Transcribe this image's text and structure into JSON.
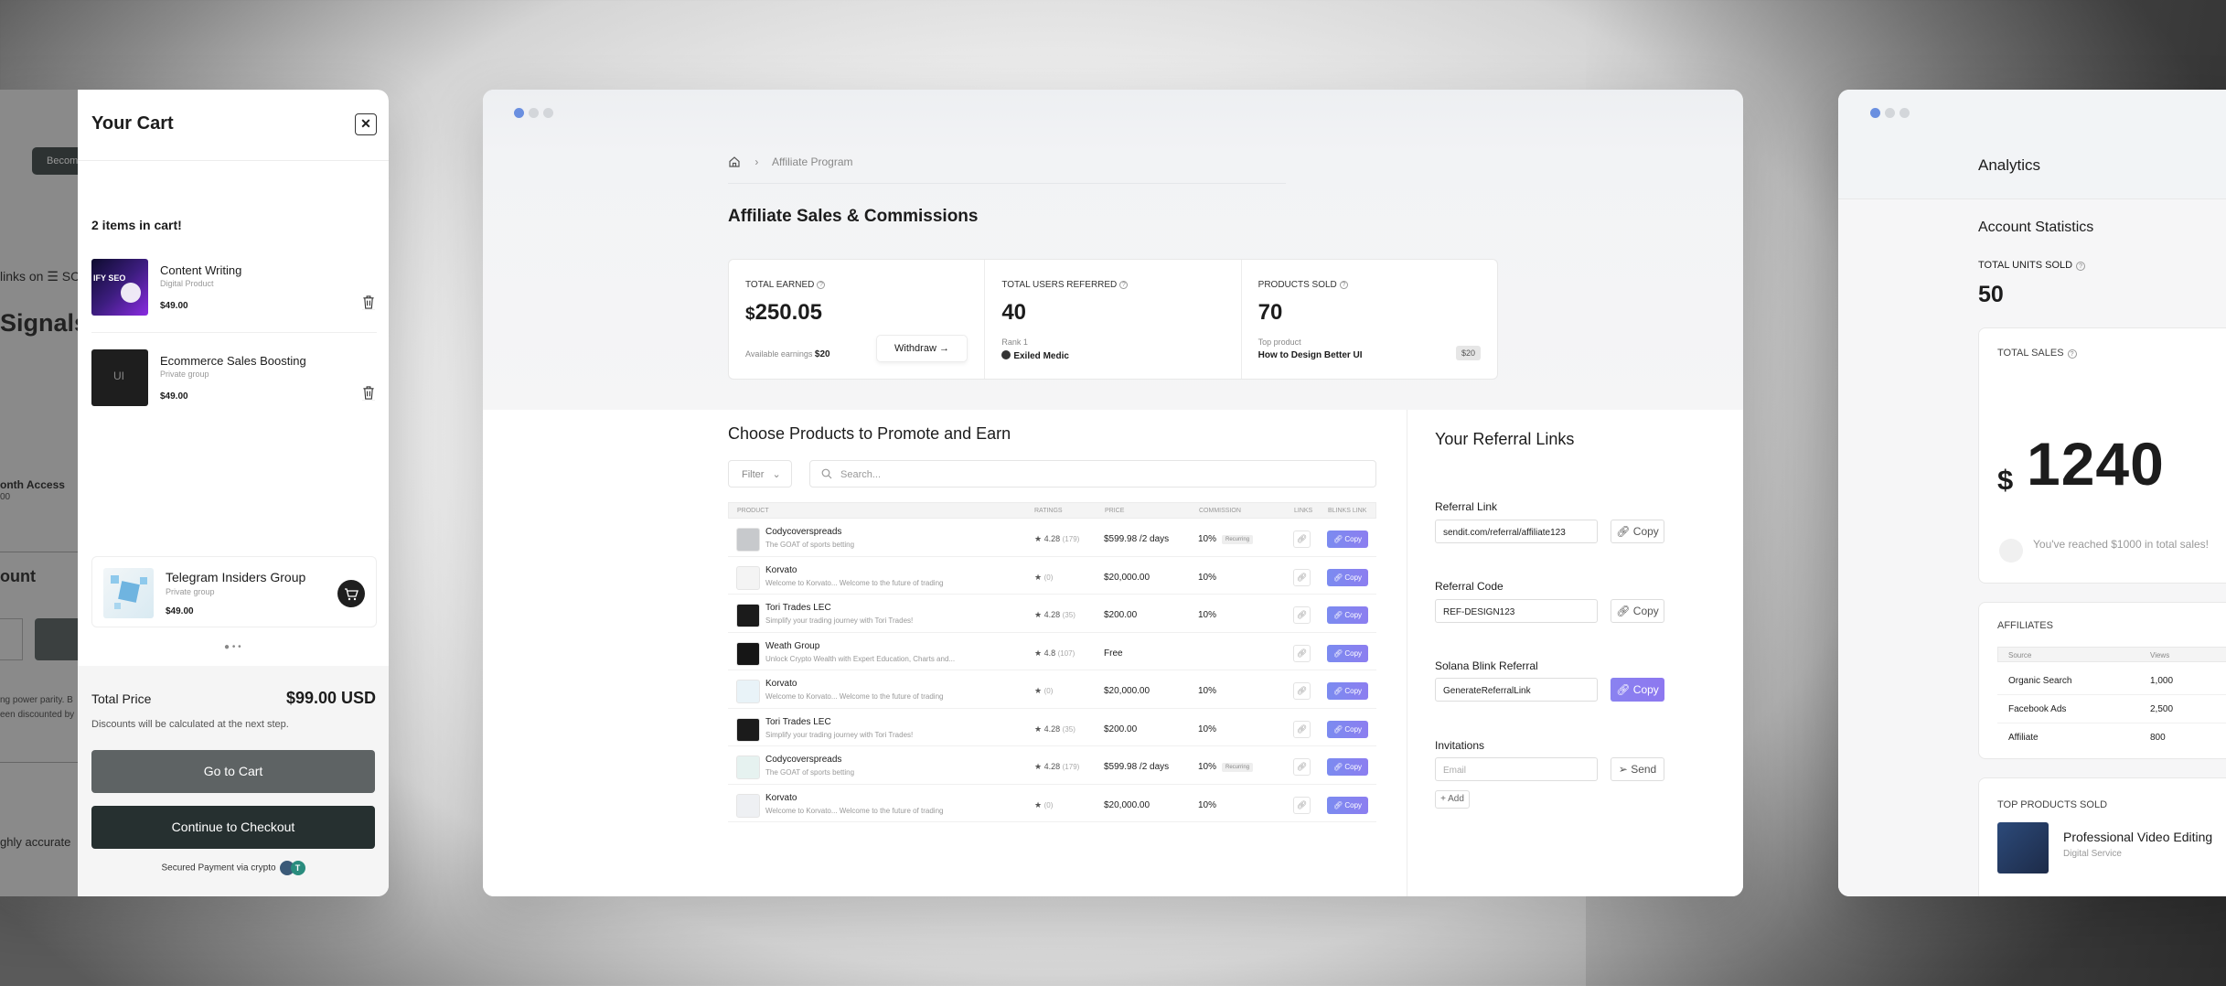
{
  "left_window": {
    "behind": {
      "button": "Become",
      "t1": "links on ☰ SC",
      "t2": "Signals",
      "t3": "onth Access",
      "t3b": "00",
      "t4": "ount",
      "t5a": "ng power parity. B",
      "t5b": "een discounted by",
      "t6": "ghly accurate"
    },
    "cart": {
      "title": "Your Cart",
      "count": "2 items in cart!",
      "items": [
        {
          "name": "Content Writing",
          "sub": "Digital Product",
          "price": "$49.00"
        },
        {
          "name": "Ecommerce Sales Boosting",
          "sub": "Private group",
          "price": "$49.00"
        }
      ],
      "thumb1_text": "IFY SEO",
      "thumb2_text": "UI",
      "recommended": {
        "name": "Telegram Insiders Group",
        "sub": "Private group",
        "price": "$49.00"
      },
      "dots": "● • •",
      "total_label": "Total Price",
      "total_value": "$99.00 USD",
      "discount_note": "Discounts will be calculated at the next step.",
      "go_to_cart": "Go to Cart",
      "checkout": "Continue to Checkout",
      "secured": "Secured Payment via crypto",
      "crypto_badge": "T"
    }
  },
  "middle_window": {
    "breadcrumb": {
      "page": "Affiliate Program",
      "sep": "›"
    },
    "title": "Affiliate Sales & Commissions",
    "stats": {
      "earned_label": "TOTAL EARNED",
      "earned_currency": "$",
      "earned_value": "250.05",
      "available_label": "Available earnings",
      "available_value": "$20",
      "withdraw": "Withdraw",
      "users_label": "TOTAL USERS REFERRED",
      "users_value": "40",
      "rank_label": "Rank 1",
      "rank_name": "Exiled Medic",
      "sold_label": "PRODUCTS SOLD",
      "sold_value": "70",
      "top_label": "Top product",
      "top_name": "How to Design Better UI",
      "top_price": "$20"
    },
    "products": {
      "title": "Choose Products to Promote and Earn",
      "filter": "Filter",
      "search_placeholder": "Search...",
      "headers": {
        "product": "PRODUCT",
        "ratings": "RATINGS",
        "price": "PRICE",
        "commission": "COMMISSION",
        "links": "LINKS",
        "blinks": "BLINKS LINK"
      },
      "copy_label": "Copy",
      "recurring": "Recurring",
      "rows": [
        {
          "name": "Codycoverspreads",
          "desc": "The GOAT of sports betting",
          "rating": "4.28",
          "count": "(179)",
          "price": "$599.98 /2 days",
          "commission": "10%"
        },
        {
          "name": "Korvato",
          "desc": "Welcome to Korvato... Welcome to the future of trading",
          "rating": "",
          "count": "(0)",
          "price": "$20,000.00",
          "commission": "10%"
        },
        {
          "name": "Tori Trades LEC",
          "desc": "Simplify your trading journey with Tori Trades!",
          "rating": "4.28",
          "count": "(35)",
          "price": "$200.00",
          "commission": "10%"
        },
        {
          "name": "Weath Group",
          "desc": "Unlock Crypto Wealth with Expert Education, Charts and...",
          "rating": "4.8",
          "count": "(107)",
          "price": "Free",
          "commission": ""
        },
        {
          "name": "Korvato",
          "desc": "Welcome to Korvato... Welcome to the future of trading",
          "rating": "",
          "count": "(0)",
          "price": "$20,000.00",
          "commission": "10%"
        },
        {
          "name": "Tori Trades LEC",
          "desc": "Simplify your trading journey with Tori Trades!",
          "rating": "4.28",
          "count": "(35)",
          "price": "$200.00",
          "commission": "10%"
        },
        {
          "name": "Codycoverspreads",
          "desc": "The GOAT of sports betting",
          "rating": "4.28",
          "count": "(179)",
          "price": "$599.98 /2 days",
          "commission": "10%"
        },
        {
          "name": "Korvato",
          "desc": "Welcome to Korvato... Welcome to the future of trading",
          "rating": "",
          "count": "(0)",
          "price": "$20,000.00",
          "commission": "10%"
        }
      ]
    },
    "referral": {
      "title": "Your Referral Links",
      "link_label": "Referral Link",
      "link_value": "sendit.com/referral/affiliate123",
      "code_label": "Referral Code",
      "code_value": "REF-DESIGN123",
      "blink_label": "Solana Blink Referral",
      "blink_value": "GenerateReferralLink",
      "copy": "Copy",
      "invitations_label": "Invitations",
      "email_placeholder": "Email",
      "send": "Send",
      "add": "+ Add"
    }
  },
  "right_window": {
    "header": "Analytics",
    "section": "Account Statistics",
    "units_label": "TOTAL UNITS SOLD",
    "units_value": "50",
    "sales_label": "TOTAL SALES",
    "sales_currency": "$",
    "sales_value": "1240",
    "milestone": "You've reached $1000 in total sales!",
    "affiliates": {
      "label": "AFFILIATES",
      "col_source": "Source",
      "col_views": "Views",
      "rows": [
        {
          "source": "Organic Search",
          "views": "1,000"
        },
        {
          "source": "Facebook Ads",
          "views": "2,500"
        },
        {
          "source": "Affiliate",
          "views": "800"
        }
      ]
    },
    "top_products": {
      "label": "TOP PRODUCTS SOLD",
      "name": "Professional Video Editing",
      "sub": "Digital Service"
    }
  },
  "colors": {
    "accent": "#7b8bf0",
    "dark": "#263030",
    "window_active_dot": "#6a8fe0"
  }
}
